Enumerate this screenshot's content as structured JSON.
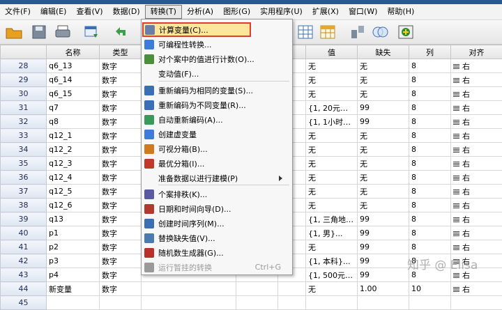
{
  "menubar": {
    "items": [
      {
        "label": "文件(F)"
      },
      {
        "label": "编辑(E)"
      },
      {
        "label": "查看(V)"
      },
      {
        "label": "数据(D)"
      },
      {
        "label": "转换(T)"
      },
      {
        "label": "分析(A)"
      },
      {
        "label": "图形(G)"
      },
      {
        "label": "实用程序(U)"
      },
      {
        "label": "扩展(X)"
      },
      {
        "label": "窗口(W)"
      },
      {
        "label": "帮助(H)"
      }
    ]
  },
  "grid": {
    "headers": [
      "",
      "名称",
      "类型",
      "",
      "",
      "",
      "值",
      "缺失",
      "列",
      "对齐"
    ],
    "rows": [
      {
        "num": "28",
        "name": "q6_13",
        "type": "数字",
        "value": "无",
        "missing": "无",
        "cols": "8",
        "align": "右"
      },
      {
        "num": "29",
        "name": "q6_14",
        "type": "数字",
        "value": "无",
        "missing": "无",
        "cols": "8",
        "align": "右"
      },
      {
        "num": "30",
        "name": "q6_15",
        "type": "数字",
        "value": "无",
        "missing": "无",
        "cols": "8",
        "align": "右"
      },
      {
        "num": "31",
        "name": "q7",
        "type": "数字",
        "value": "{1, 20元以下...",
        "missing": "99",
        "cols": "8",
        "align": "右"
      },
      {
        "num": "32",
        "name": "q8",
        "type": "数字",
        "value": "{1, 1小时以...",
        "missing": "99",
        "cols": "8",
        "align": "右"
      },
      {
        "num": "33",
        "name": "q12_1",
        "type": "数字",
        "value": "无",
        "missing": "无",
        "cols": "8",
        "align": "右"
      },
      {
        "num": "34",
        "name": "q12_2",
        "type": "数字",
        "value": "无",
        "missing": "无",
        "cols": "8",
        "align": "右"
      },
      {
        "num": "35",
        "name": "q12_3",
        "type": "数字",
        "value": "无",
        "missing": "无",
        "cols": "8",
        "align": "右"
      },
      {
        "num": "36",
        "name": "q12_4",
        "type": "数字",
        "value": "无",
        "missing": "无",
        "cols": "8",
        "align": "右"
      },
      {
        "num": "37",
        "name": "q12_5",
        "type": "数字",
        "value": "无",
        "missing": "无",
        "cols": "8",
        "align": "右"
      },
      {
        "num": "38",
        "name": "q12_6",
        "type": "数字",
        "value": "无",
        "missing": "无",
        "cols": "8",
        "align": "右"
      },
      {
        "num": "39",
        "name": "q13",
        "type": "数字",
        "value": "{1, 三角地}...",
        "missing": "99",
        "cols": "8",
        "align": "右"
      },
      {
        "num": "40",
        "name": "p1",
        "type": "数字",
        "value": "{1, 男}...",
        "missing": "99",
        "cols": "8",
        "align": "右"
      },
      {
        "num": "41",
        "name": "p2",
        "type": "数字",
        "value": "无",
        "missing": "99",
        "cols": "8",
        "align": "右"
      },
      {
        "num": "42",
        "name": "p3",
        "type": "数字",
        "value": "{1, 本科}...",
        "missing": "99",
        "cols": "8",
        "align": "右"
      },
      {
        "num": "43",
        "name": "p4",
        "type": "数字",
        "value": "{1, 500元以...",
        "missing": "99",
        "cols": "8",
        "align": "右"
      },
      {
        "num": "44",
        "name": "新变量",
        "type": "数字",
        "value": "无",
        "missing": "1.00",
        "cols": "10",
        "align": "右"
      },
      {
        "num": "45",
        "name": "",
        "type": "",
        "value": "",
        "missing": "",
        "cols": "",
        "align": ""
      }
    ]
  },
  "dropdown": {
    "items": [
      {
        "label": "计算变量(C)...",
        "icon_color": "#6a7fa8",
        "shortcut": ""
      },
      {
        "label": "可编程性转换...",
        "icon_color": "#3b7dd8",
        "shortcut": ""
      },
      {
        "label": "对个案中的值进行计数(O)...",
        "icon_color": "#4a8f3a",
        "shortcut": ""
      },
      {
        "label": "变动值(F)...",
        "icon_color": "",
        "shortcut": ""
      },
      {
        "label": "重新编码为相同的变量(S)...",
        "icon_color": "#3b6fb5",
        "shortcut": ""
      },
      {
        "label": "重新编码为不同变量(R)...",
        "icon_color": "#3b6fb5",
        "shortcut": ""
      },
      {
        "label": "自动重新编码(A)...",
        "icon_color": "#3a9a5a",
        "shortcut": ""
      },
      {
        "label": "创建虚变量",
        "icon_color": "#3b7dd8",
        "shortcut": ""
      },
      {
        "label": "可视分箱(B)...",
        "icon_color": "#d07a20",
        "shortcut": ""
      },
      {
        "label": "最优分箱(I)...",
        "icon_color": "#c0392b",
        "shortcut": ""
      },
      {
        "label": "准备数据以进行建模(P)",
        "icon_color": "",
        "shortcut": ""
      },
      {
        "label": "个案排秩(K)...",
        "icon_color": "#5a5aa0",
        "shortcut": ""
      },
      {
        "label": "日期和时间向导(D)...",
        "icon_color": "#b03a2e",
        "shortcut": ""
      },
      {
        "label": "创建时间序列(M)...",
        "icon_color": "#3b6fb5",
        "shortcut": ""
      },
      {
        "label": "替换缺失值(V)...",
        "icon_color": "#4a7ab0",
        "shortcut": ""
      },
      {
        "label": "随机数生成器(G)...",
        "icon_color": "#b8322a",
        "shortcut": ""
      },
      {
        "label": "运行暂挂的转换",
        "icon_color": "#9a9a9a",
        "shortcut": "Ctrl+G"
      }
    ]
  },
  "watermark": {
    "text": "知乎 @ Elisa"
  },
  "colors": {
    "highlight_border": "#e03c31",
    "highlight_bg": "#fde59b",
    "menu_bg": "#f7f7f7"
  }
}
